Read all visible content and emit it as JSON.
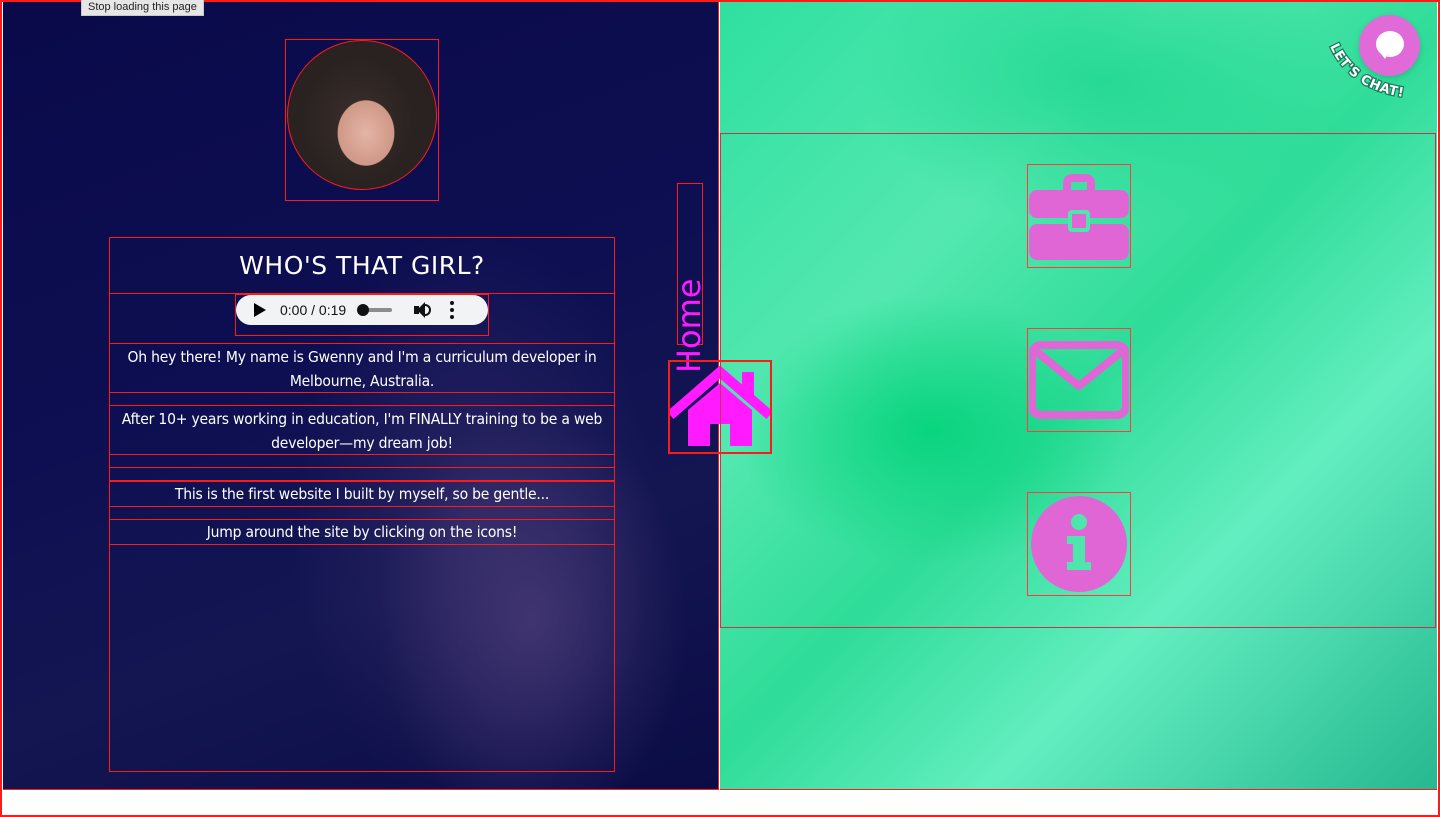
{
  "browser": {
    "tooltip": "Stop loading this page"
  },
  "profile": {
    "heading": "WHO'S THAT GIRL?",
    "audio": {
      "time": "0:00 / 0:19",
      "progress": 0.0
    },
    "paragraphs": [
      "Oh hey there! My name is Gwenny and I'm a curriculum developer in Melbourne, Australia.",
      "After 10+ years working in education, I'm FINALLY training to be a web developer—my dream job!",
      "This is the first website I built by myself, so be gentle...",
      "Jump around the site by clicking on the icons!"
    ]
  },
  "nav": {
    "home_label": "Home",
    "icons": [
      "briefcase-icon",
      "envelope-icon",
      "info-icon"
    ]
  },
  "chat": {
    "label": "LET'S CHAT!"
  },
  "colors": {
    "accent": "#ff1aff",
    "icon_pink": "#e066d6",
    "left_bg": "#0d0f52",
    "right_bg": "#4fe6ae",
    "outline": "#ff1a1a"
  }
}
